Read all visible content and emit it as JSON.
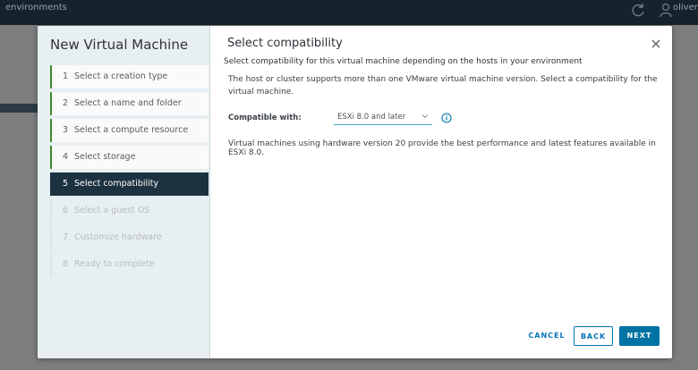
{
  "topbar": {
    "breadcrumb": "environments",
    "username": "oliver",
    "refresh_icon": "refresh-icon",
    "user_icon": "user-icon"
  },
  "wizard": {
    "title": "New Virtual Machine",
    "steps": [
      {
        "num": "1",
        "label": "Select a creation type",
        "state": "done"
      },
      {
        "num": "2",
        "label": "Select a name and folder",
        "state": "done"
      },
      {
        "num": "3",
        "label": "Select a compute resource",
        "state": "done"
      },
      {
        "num": "4",
        "label": "Select storage",
        "state": "done"
      },
      {
        "num": "5",
        "label": "Select compatibility",
        "state": "active"
      },
      {
        "num": "6",
        "label": "Select a guest OS",
        "state": "future"
      },
      {
        "num": "7",
        "label": "Customize hardware",
        "state": "future"
      },
      {
        "num": "8",
        "label": "Ready to complete",
        "state": "future"
      }
    ]
  },
  "page": {
    "heading": "Select compatibility",
    "subtitle": "Select compatibility for this virtual machine depending on the hosts in your environment",
    "description": "The host or cluster supports more than one VMware virtual machine version. Select a compatibility for the virtual machine.",
    "compat_label": "Compatible with:",
    "compat_value": "ESXi 8.0 and later",
    "hw_note": "Virtual machines using hardware version 20 provide the best performance and latest features available in ESXi 8.0."
  },
  "buttons": {
    "cancel": "CANCEL",
    "back": "BACK",
    "next": "NEXT"
  },
  "colors": {
    "accent": "#0072a3",
    "active_step": "#1d3240",
    "done_marker": "#3d8b27"
  }
}
